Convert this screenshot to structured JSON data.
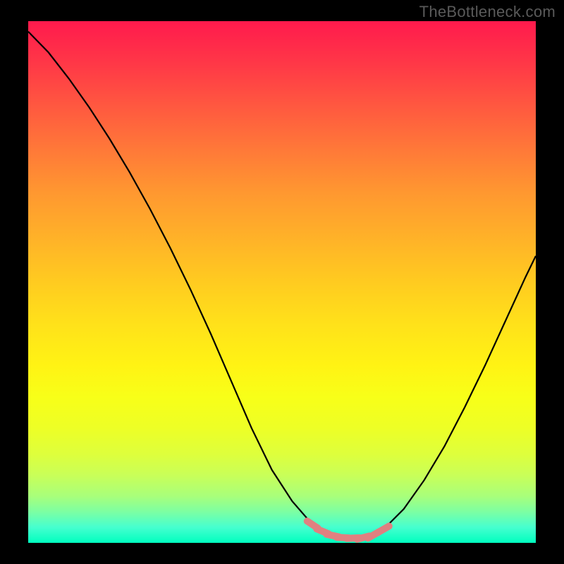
{
  "watermark": "TheBottleneck.com",
  "gradient": {
    "top": "#ff1a4d",
    "mid": "#ffe11a",
    "bottom": "#00ffbf"
  },
  "chart_data": {
    "type": "line",
    "title": "",
    "xlabel": "",
    "ylabel": "",
    "xlim": [
      0,
      100
    ],
    "ylim": [
      0,
      100
    ],
    "grid": false,
    "legend": null,
    "series": [
      {
        "name": "curve",
        "color": "#000000",
        "x": [
          0,
          4,
          8,
          12,
          16,
          20,
          24,
          28,
          32,
          36,
          40,
          44,
          48,
          52,
          56,
          58,
          60,
          62,
          64,
          66,
          68,
          70,
          74,
          78,
          82,
          86,
          90,
          94,
          98,
          100
        ],
        "values": [
          98,
          94,
          89,
          83.5,
          77.5,
          71,
          64,
          56.5,
          48.5,
          40,
          31,
          22,
          14,
          8,
          3.5,
          2.2,
          1.4,
          1.0,
          0.9,
          1.0,
          1.5,
          2.6,
          6.5,
          12,
          18.5,
          26,
          34,
          42.5,
          51,
          55
        ]
      },
      {
        "name": "highlight-dots",
        "color": "#e08080",
        "style": "dotted-segment",
        "x": [
          56,
          58,
          60,
          62,
          64,
          66,
          68,
          70
        ],
        "values": [
          3.5,
          2.2,
          1.4,
          1.0,
          0.9,
          1.0,
          1.5,
          2.6
        ]
      }
    ]
  }
}
